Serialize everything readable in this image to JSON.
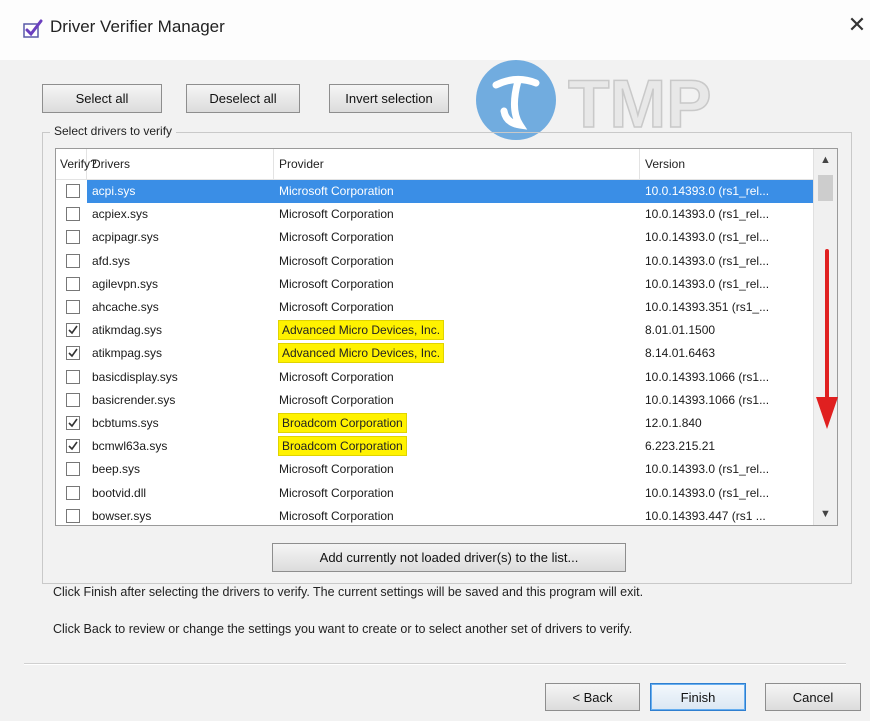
{
  "window": {
    "title": "Driver Verifier Manager",
    "close_label": "✕"
  },
  "toolbar": {
    "select_all": "Select all",
    "deselect_all": "Deselect all",
    "invert_selection": "Invert selection"
  },
  "group_label": "Select drivers to verify",
  "columns": [
    "Verify?",
    "Drivers",
    "Provider",
    "Version"
  ],
  "rows": [
    {
      "checked": false,
      "selected": true,
      "highlight": false,
      "driver": "acpi.sys",
      "provider": "Microsoft Corporation",
      "version": "10.0.14393.0 (rs1_rel..."
    },
    {
      "checked": false,
      "selected": false,
      "highlight": false,
      "driver": "acpiex.sys",
      "provider": "Microsoft Corporation",
      "version": "10.0.14393.0 (rs1_rel..."
    },
    {
      "checked": false,
      "selected": false,
      "highlight": false,
      "driver": "acpipagr.sys",
      "provider": "Microsoft Corporation",
      "version": "10.0.14393.0 (rs1_rel..."
    },
    {
      "checked": false,
      "selected": false,
      "highlight": false,
      "driver": "afd.sys",
      "provider": "Microsoft Corporation",
      "version": "10.0.14393.0 (rs1_rel..."
    },
    {
      "checked": false,
      "selected": false,
      "highlight": false,
      "driver": "agilevpn.sys",
      "provider": "Microsoft Corporation",
      "version": "10.0.14393.0 (rs1_rel..."
    },
    {
      "checked": false,
      "selected": false,
      "highlight": false,
      "driver": "ahcache.sys",
      "provider": "Microsoft Corporation",
      "version": "10.0.14393.351 (rs1_..."
    },
    {
      "checked": true,
      "selected": false,
      "highlight": true,
      "driver": "atikmdag.sys",
      "provider": "Advanced Micro Devices, Inc.",
      "version": "8.01.01.1500"
    },
    {
      "checked": true,
      "selected": false,
      "highlight": true,
      "driver": "atikmpag.sys",
      "provider": "Advanced Micro Devices, Inc.",
      "version": "8.14.01.6463"
    },
    {
      "checked": false,
      "selected": false,
      "highlight": false,
      "driver": "basicdisplay.sys",
      "provider": "Microsoft Corporation",
      "version": "10.0.14393.1066 (rs1..."
    },
    {
      "checked": false,
      "selected": false,
      "highlight": false,
      "driver": "basicrender.sys",
      "provider": "Microsoft Corporation",
      "version": "10.0.14393.1066 (rs1..."
    },
    {
      "checked": true,
      "selected": false,
      "highlight": true,
      "driver": "bcbtums.sys",
      "provider": "Broadcom Corporation",
      "version": "12.0.1.840"
    },
    {
      "checked": true,
      "selected": false,
      "highlight": true,
      "driver": "bcmwl63a.sys",
      "provider": "Broadcom Corporation",
      "version": "6.223.215.21"
    },
    {
      "checked": false,
      "selected": false,
      "highlight": false,
      "driver": "beep.sys",
      "provider": "Microsoft Corporation",
      "version": "10.0.14393.0 (rs1_rel..."
    },
    {
      "checked": false,
      "selected": false,
      "highlight": false,
      "driver": "bootvid.dll",
      "provider": "Microsoft Corporation",
      "version": "10.0.14393.0 (rs1_rel..."
    },
    {
      "checked": false,
      "selected": false,
      "highlight": false,
      "driver": "bowser.sys",
      "provider": "Microsoft Corporation",
      "version": "10.0.14393.447 (rs1 ..."
    }
  ],
  "add_button": "Add currently not loaded driver(s) to the list...",
  "info": {
    "finish_text": "Click Finish after selecting the drivers to verify. The current settings will be saved and this program will exit.",
    "back_text": "Click Back to review or change the settings you want to create or to select another set of drivers to verify."
  },
  "footer": {
    "back": "< Back",
    "finish": "Finish",
    "cancel": "Cancel"
  },
  "watermark_text": "TMP",
  "colors": {
    "selection": "#3a8ee6",
    "highlight": "#fff200",
    "arrow": "#e02020",
    "focus": "#2f7fd0"
  }
}
